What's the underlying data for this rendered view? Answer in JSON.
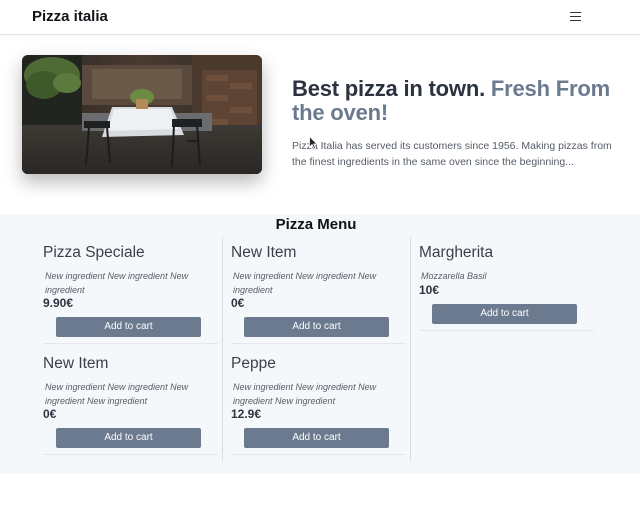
{
  "navbar": {
    "brand": "Pizza italia",
    "menu_icon": "hamburger-menu-icon"
  },
  "hero": {
    "title_main": "Best pizza in town.",
    "title_accent": "Fresh From the oven!",
    "description": "Pizza Italia has served its customers since 1956. Making pizzas from the finest ingredients in the same oven since the beginning..."
  },
  "menu": {
    "title": "Pizza Menu",
    "items": [
      {
        "name": "Pizza Speciale",
        "ingredients": "New ingredient New ingredient New ingredient",
        "price": "9.90€",
        "button": "Add to cart"
      },
      {
        "name": "New Item",
        "ingredients": "New ingredient New ingredient New ingredient",
        "price": "0€",
        "button": "Add to cart"
      },
      {
        "name": "Margherita",
        "ingredients": "Mozzarella Basil",
        "price": "10€",
        "button": "Add to cart"
      },
      {
        "name": "New Item",
        "ingredients": "New ingredient New ingredient New ingredient New ingredient",
        "price": "0€",
        "button": "Add to cart"
      },
      {
        "name": "Peppe",
        "ingredients": "New ingredient New ingredient New ingredient New ingredient",
        "price": "12.9€",
        "button": "Add to cart"
      }
    ]
  },
  "colors": {
    "accent": "#6c7a90",
    "menu_bg": "#f5f8fb"
  }
}
